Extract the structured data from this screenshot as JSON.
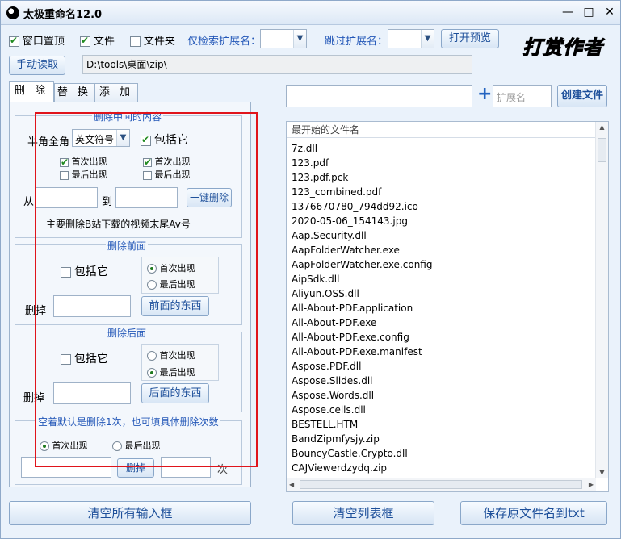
{
  "titlebar": {
    "title": "太极重命名12.0",
    "minimize": "—",
    "maximize": "□",
    "close": "✕"
  },
  "toolbar": {
    "window_top": "窗口置顶",
    "files": "文件",
    "folders": "文件夹",
    "only_ext_label": "仅检索扩展名：",
    "skip_ext_label": "跳过扩展名：",
    "open_preview": "打开预览",
    "manual_read": "手动读取",
    "path": "D:\\tools\\桌面\\zip\\",
    "logo": "打赏作者"
  },
  "tabs": [
    "删 除",
    "替 换",
    "添 加"
  ],
  "delete_middle": {
    "title": "删除中间的内容",
    "width_label": "半角全角",
    "symbol_select": "英文符号",
    "include_label": "包括它",
    "first1": "首次出现",
    "last1": "最后出现",
    "first2": "首次出现",
    "last2": "最后出现",
    "from_label": "从",
    "to_label": "到",
    "one_click": "一键删除",
    "note": "主要删除B站下载的视频末尾Av号"
  },
  "delete_front": {
    "title": "删除前面",
    "include_label": "包括它",
    "first": "首次出现",
    "last": "最后出现",
    "delete_label": "删掉",
    "button": "前面的东西"
  },
  "delete_back": {
    "title": "删除后面",
    "include_label": "包括它",
    "first": "首次出现",
    "last": "最后出现",
    "delete_label": "删掉",
    "button": "后面的东西"
  },
  "delete_count": {
    "title": "空着默认是删除1次，也可填具体删除次数",
    "first": "首次出现",
    "last": "最后出现",
    "button": "删掉",
    "unit": "次"
  },
  "right": {
    "plus": "+",
    "ext_placeholder": "扩展名",
    "create_file": "创建文件",
    "list_header": "最开始的文件名",
    "files": [
      "7z.dll",
      "123.pdf",
      "123.pdf.pck",
      "123_combined.pdf",
      "1376670780_794dd92.ico",
      "2020-05-06_154143.jpg",
      "Aap.Security.dll",
      "AapFolderWatcher.exe",
      "AapFolderWatcher.exe.config",
      "AipSdk.dll",
      "Aliyun.OSS.dll",
      "All-About-PDF.application",
      "All-About-PDF.exe",
      "All-About-PDF.exe.config",
      "All-About-PDF.exe.manifest",
      "Aspose.PDF.dll",
      "Aspose.Slides.dll",
      "Aspose.Words.dll",
      "Aspose.cells.dll",
      "BESTELL.HTM",
      "BandZipmfysjy.zip",
      "BouncyCastle.Crypto.dll",
      "CAJViewerdzydq.zip"
    ]
  },
  "bottom": {
    "clear_inputs": "清空所有输入框",
    "clear_list": "清空列表框",
    "save_txt": "保存原文件名到txt"
  }
}
